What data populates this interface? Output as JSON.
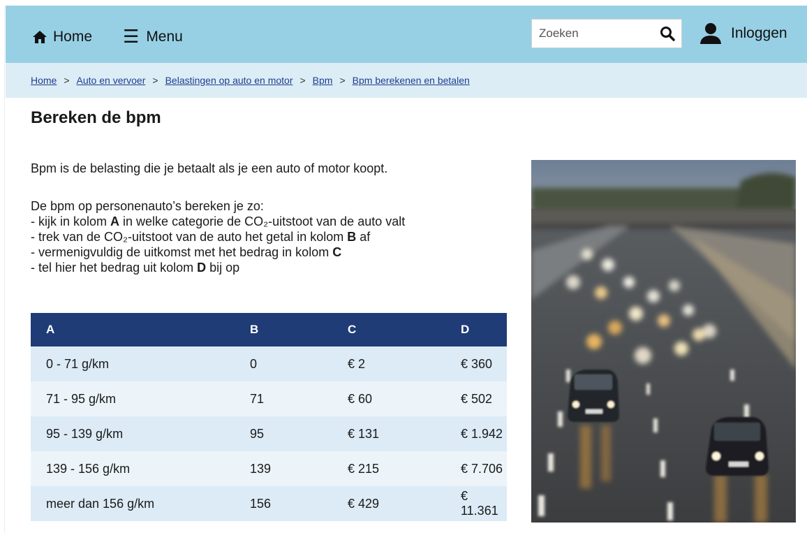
{
  "header": {
    "home_label": "Home",
    "menu_label": "Menu",
    "search_placeholder": "Zoeken",
    "login_label": "Inloggen",
    "bar_color": "#97d0e4"
  },
  "breadcrumb": {
    "items": [
      "Home",
      "Auto en vervoer",
      "Belastingen op auto en motor",
      "Bpm",
      "Bpm berekenen en betalen"
    ],
    "separator": ">"
  },
  "page": {
    "title": "Bereken de bpm",
    "intro": "Bpm is de belasting die je betaalt als je een auto of motor koopt.",
    "rules_intro": "De bpm op personenauto’s bereken je zo:",
    "rules": [
      {
        "pre": "- kijk in kolom ",
        "bold": "A",
        "post": " in welke categorie de CO₂-uitstoot van de auto valt"
      },
      {
        "pre": "- trek van de CO₂-uitstoot van de auto het getal in kolom ",
        "bold": "B",
        "post": " af"
      },
      {
        "pre": "- vermenigvuldig de uitkomst met het bedrag in kolom ",
        "bold": "C",
        "post": ""
      },
      {
        "pre": "- tel hier het bedrag uit kolom ",
        "bold": "D",
        "post": " bij op"
      }
    ]
  },
  "table": {
    "headers": [
      "A",
      "B",
      "C",
      "D"
    ],
    "rows": [
      [
        "0 - 71  g/km",
        "0",
        "€ 2",
        "€ 360"
      ],
      [
        "71 - 95  g/km",
        "71",
        "€ 60",
        "€ 502"
      ],
      [
        "95 - 139  g/km",
        "95",
        "€ 131",
        "€ 1.942"
      ],
      [
        "139 - 156  g/km",
        "139",
        "€ 215",
        "€ 7.706"
      ],
      [
        "meer dan 156 g/km",
        "156",
        "€ 429",
        "€ 11.361"
      ]
    ],
    "header_color": "#1f3c77"
  },
  "icons": {
    "home": "home-icon",
    "menu": "hamburger-icon",
    "search": "search-icon",
    "login": "user-icon"
  }
}
